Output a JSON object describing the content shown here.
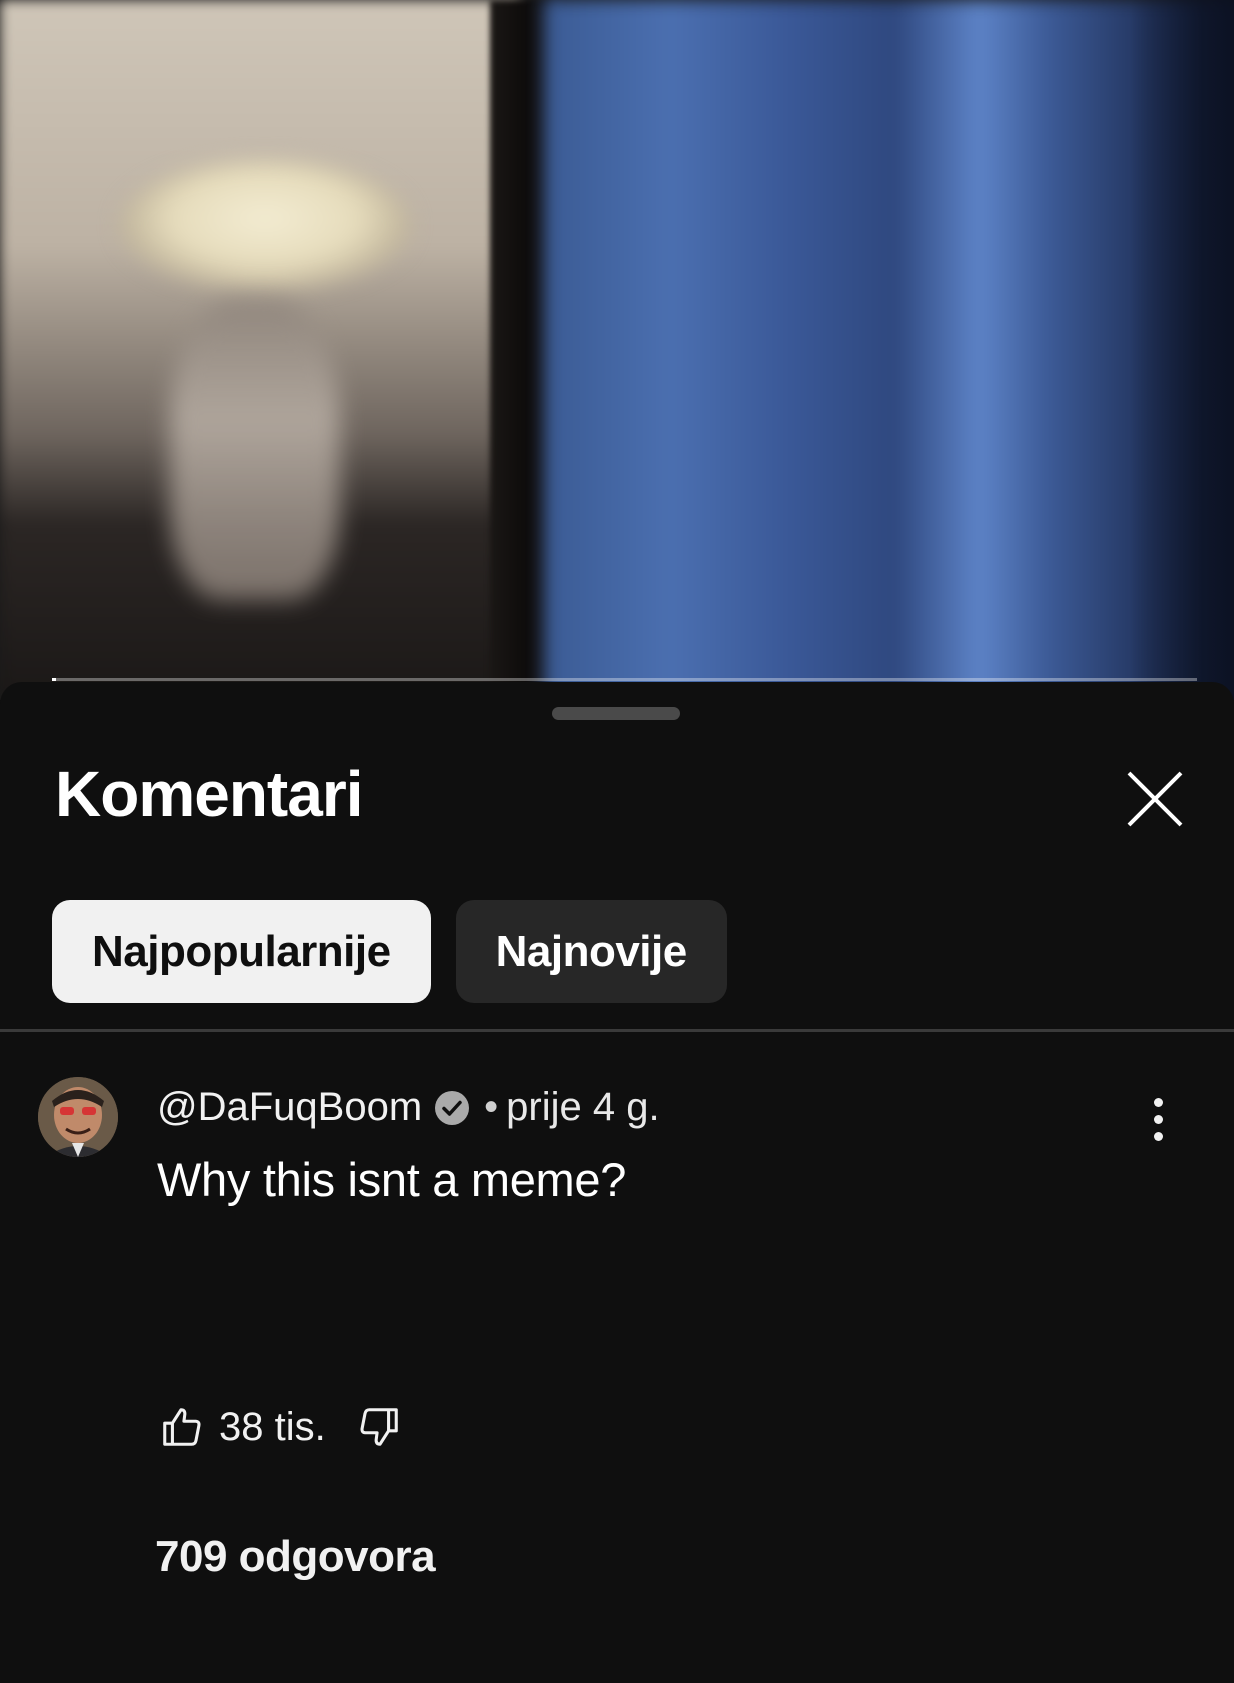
{
  "video": {
    "progress_fraction": 0.003
  },
  "comments_panel": {
    "title": "Komentari",
    "close_icon": "close-icon",
    "sort_chips": [
      {
        "label": "Najpopularnije",
        "selected": true
      },
      {
        "label": "Najnovije",
        "selected": false
      }
    ]
  },
  "comment": {
    "author": "@DaFuqBoom",
    "verified_icon": "verified-check-icon",
    "separator": "•",
    "time": "prije 4 g.",
    "text": "Why this isnt a meme?",
    "like_icon": "thumbs-up-icon",
    "like_count": "38 tis.",
    "dislike_icon": "thumbs-down-icon",
    "more_icon": "more-vertical-icon",
    "replies": "709 odgovora"
  },
  "colors": {
    "background": "#0f0f0f",
    "chip_active": "#f1f1f1",
    "chip_inactive": "#272727",
    "text": "#ffffff"
  }
}
